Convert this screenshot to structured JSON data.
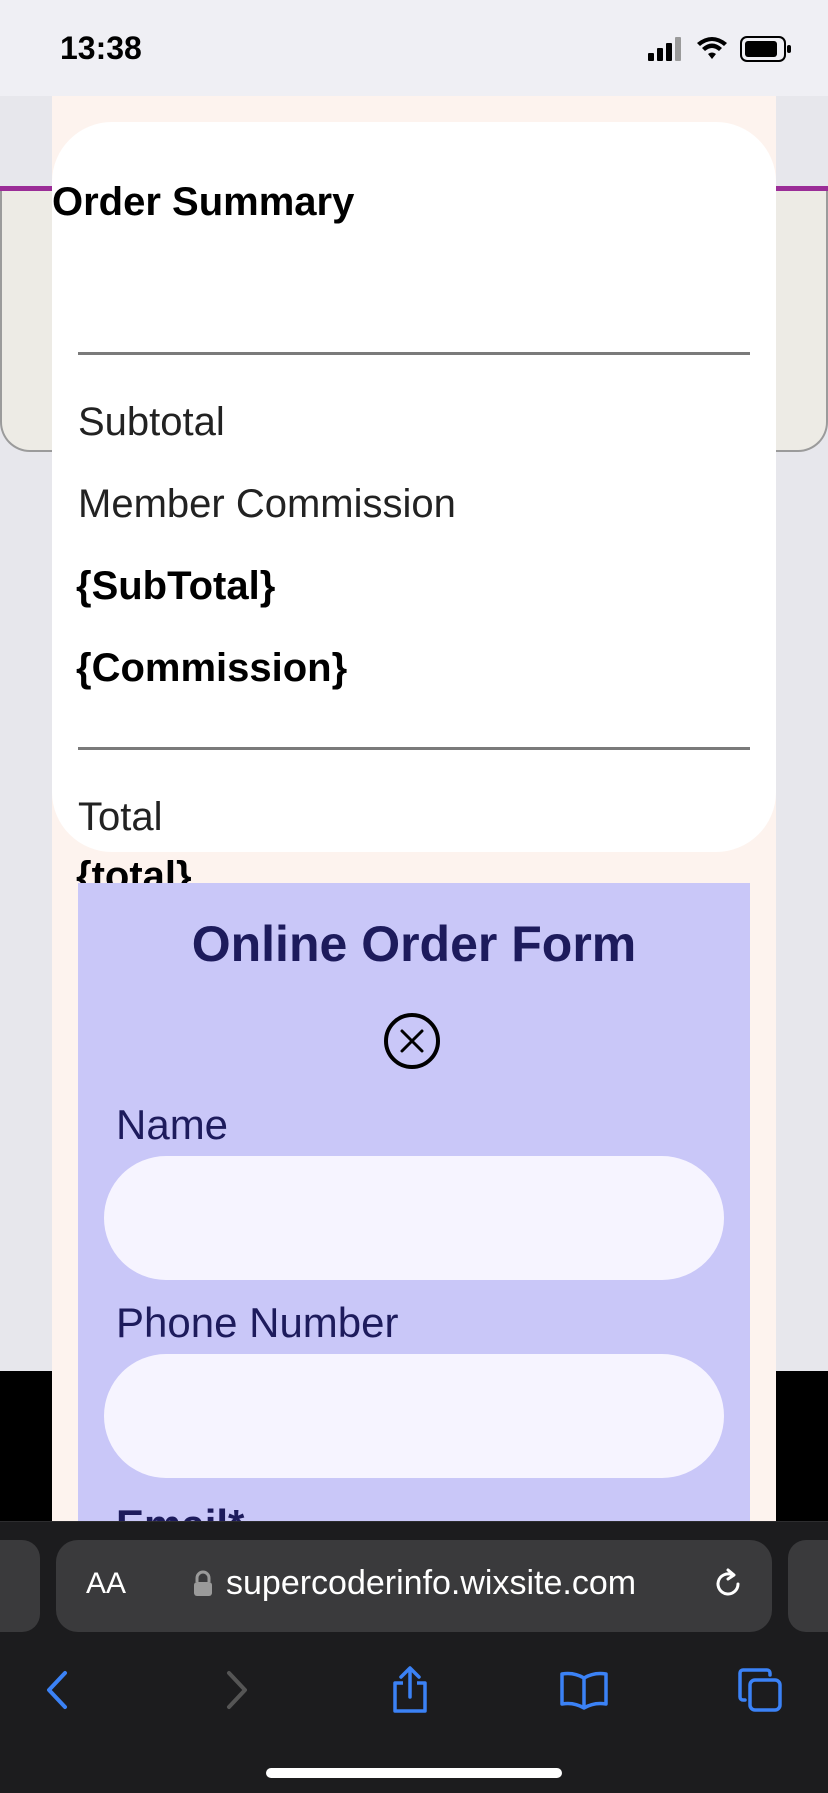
{
  "status_bar": {
    "time": "13:38"
  },
  "order_summary": {
    "title": "Order Summary",
    "subtotal_label": "Subtotal",
    "commission_label": "Member Commission",
    "subtotal_value": "{SubTotal}",
    "commission_value": "{Commission}",
    "total_label": "Total",
    "total_value": "{total}"
  },
  "order_form": {
    "title": "Online Order Form",
    "fields": [
      {
        "label": "Name",
        "value": ""
      },
      {
        "label": "Phone Number",
        "value": ""
      }
    ],
    "partial_field_label": "Email*"
  },
  "browser": {
    "aa_label": "AA",
    "url": "supercoderinfo.wixsite.com"
  },
  "colors": {
    "accent": "#9b2d97",
    "form_background": "#c9c7f8",
    "form_text": "#1d1b5c",
    "browser_icons": "#3b82f6"
  }
}
